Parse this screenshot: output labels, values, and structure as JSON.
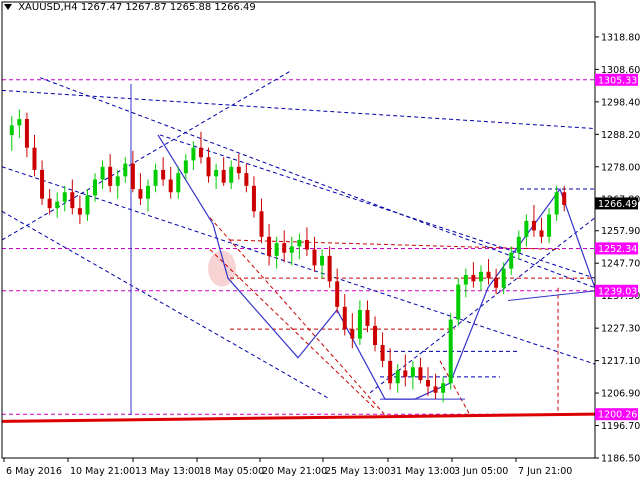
{
  "window": {
    "symbol": "XAUUSD,H4",
    "ohlc": "1267.47 1267.87 1265.88 1266.49"
  },
  "colors": {
    "bull": "#00cc00",
    "bear": "#cc0000",
    "grid": "#ffffff",
    "axis": "#000000",
    "label_bg": "#ff00ff",
    "label_text": "#ffffff",
    "dashed_blue": "#0000aa",
    "dashed_red": "#cc0000",
    "magenta": "#cc00cc",
    "solid_blue": "#3333cc",
    "support_red": "#dd0000"
  },
  "chart_data": {
    "type": "candlestick",
    "title": "XAUUSD,H4",
    "ylim": [
      1186.5,
      1326.0
    ],
    "y_ticks": [
      "1318.80",
      "1308.60",
      "1298.40",
      "1288.20",
      "1278.00",
      "1267.80",
      "1257.90",
      "1247.70",
      "1237.50",
      "1227.30",
      "1217.10",
      "1206.90",
      "1196.70",
      "1186.50"
    ],
    "x_labels": [
      "6 May 2016",
      "10 May 21:00",
      "13 May 13:00",
      "18 May 05:00",
      "20 May 21:00",
      "25 May 13:00",
      "31 May 13:00",
      "3 Jun 05:00",
      "7 Jun 21:00"
    ],
    "price_labels": [
      {
        "value": 1305.33,
        "label": "1305.33",
        "color": "#ff00ff"
      },
      {
        "value": 1266.49,
        "label": "1266.49",
        "color": "#000000"
      },
      {
        "value": 1252.34,
        "label": "1252.34",
        "color": "#ff00ff"
      },
      {
        "value": 1239.03,
        "label": "1239.03",
        "color": "#ff00ff"
      },
      {
        "value": 1200.26,
        "label": "1200.26",
        "color": "#ff00ff"
      }
    ],
    "candles": [
      [
        1288,
        1294,
        1283,
        1291
      ],
      [
        1291,
        1296,
        1287,
        1293
      ],
      [
        1293,
        1295,
        1281,
        1284
      ],
      [
        1284,
        1288,
        1275,
        1277
      ],
      [
        1277,
        1280,
        1266,
        1268
      ],
      [
        1268,
        1271,
        1263,
        1265
      ],
      [
        1265,
        1270,
        1262,
        1267
      ],
      [
        1267,
        1272,
        1264,
        1270
      ],
      [
        1270,
        1274,
        1263,
        1265
      ],
      [
        1265,
        1269,
        1260,
        1263
      ],
      [
        1263,
        1271,
        1261,
        1269
      ],
      [
        1269,
        1276,
        1267,
        1274
      ],
      [
        1274,
        1280,
        1271,
        1278
      ],
      [
        1278,
        1282,
        1270,
        1272
      ],
      [
        1272,
        1277,
        1268,
        1275
      ],
      [
        1275,
        1281,
        1273,
        1279
      ],
      [
        1279,
        1283,
        1270,
        1271
      ],
      [
        1271,
        1276,
        1266,
        1268
      ],
      [
        1268,
        1274,
        1264,
        1272
      ],
      [
        1272,
        1279,
        1270,
        1277
      ],
      [
        1277,
        1281,
        1272,
        1274
      ],
      [
        1274,
        1278,
        1268,
        1270
      ],
      [
        1270,
        1278,
        1268,
        1276
      ],
      [
        1276,
        1282,
        1274,
        1280
      ],
      [
        1280,
        1286,
        1277,
        1284
      ],
      [
        1284,
        1289,
        1279,
        1281
      ],
      [
        1281,
        1284,
        1273,
        1275
      ],
      [
        1275,
        1279,
        1271,
        1277
      ],
      [
        1277,
        1281,
        1272,
        1273
      ],
      [
        1273,
        1280,
        1271,
        1278
      ],
      [
        1278,
        1282,
        1274,
        1276
      ],
      [
        1276,
        1279,
        1270,
        1272
      ],
      [
        1272,
        1275,
        1262,
        1264
      ],
      [
        1264,
        1268,
        1254,
        1256
      ],
      [
        1256,
        1260,
        1247,
        1250
      ],
      [
        1250,
        1256,
        1246,
        1254
      ],
      [
        1254,
        1258,
        1248,
        1251
      ],
      [
        1251,
        1256,
        1247,
        1253
      ],
      [
        1253,
        1257,
        1249,
        1255
      ],
      [
        1255,
        1259,
        1250,
        1252
      ],
      [
        1252,
        1256,
        1245,
        1247
      ],
      [
        1247,
        1252,
        1243,
        1250
      ],
      [
        1250,
        1253,
        1240,
        1242
      ],
      [
        1242,
        1246,
        1232,
        1234
      ],
      [
        1234,
        1238,
        1225,
        1227
      ],
      [
        1227,
        1232,
        1221,
        1224
      ],
      [
        1224,
        1236,
        1222,
        1233
      ],
      [
        1233,
        1236,
        1226,
        1228
      ],
      [
        1228,
        1231,
        1220,
        1222
      ],
      [
        1222,
        1226,
        1215,
        1217
      ],
      [
        1217,
        1221,
        1208,
        1210
      ],
      [
        1210,
        1216,
        1207,
        1214
      ],
      [
        1214,
        1219,
        1209,
        1212
      ],
      [
        1212,
        1217,
        1208,
        1215
      ],
      [
        1215,
        1218,
        1210,
        1211
      ],
      [
        1211,
        1215,
        1206,
        1209
      ],
      [
        1209,
        1213,
        1205,
        1207
      ],
      [
        1207,
        1212,
        1204,
        1210
      ],
      [
        1210,
        1232,
        1208,
        1230
      ],
      [
        1230,
        1243,
        1228,
        1241
      ],
      [
        1241,
        1246,
        1237,
        1244
      ],
      [
        1244,
        1248,
        1240,
        1242
      ],
      [
        1242,
        1247,
        1239,
        1245
      ],
      [
        1245,
        1249,
        1241,
        1243
      ],
      [
        1243,
        1246,
        1238,
        1240
      ],
      [
        1240,
        1248,
        1238,
        1246
      ],
      [
        1246,
        1253,
        1244,
        1251
      ],
      [
        1251,
        1258,
        1249,
        1256
      ],
      [
        1256,
        1263,
        1253,
        1261
      ],
      [
        1261,
        1266,
        1256,
        1258
      ],
      [
        1258,
        1262,
        1254,
        1256
      ],
      [
        1256,
        1265,
        1254,
        1263
      ],
      [
        1263,
        1272,
        1261,
        1270
      ],
      [
        1270,
        1272,
        1264,
        1266
      ]
    ]
  }
}
